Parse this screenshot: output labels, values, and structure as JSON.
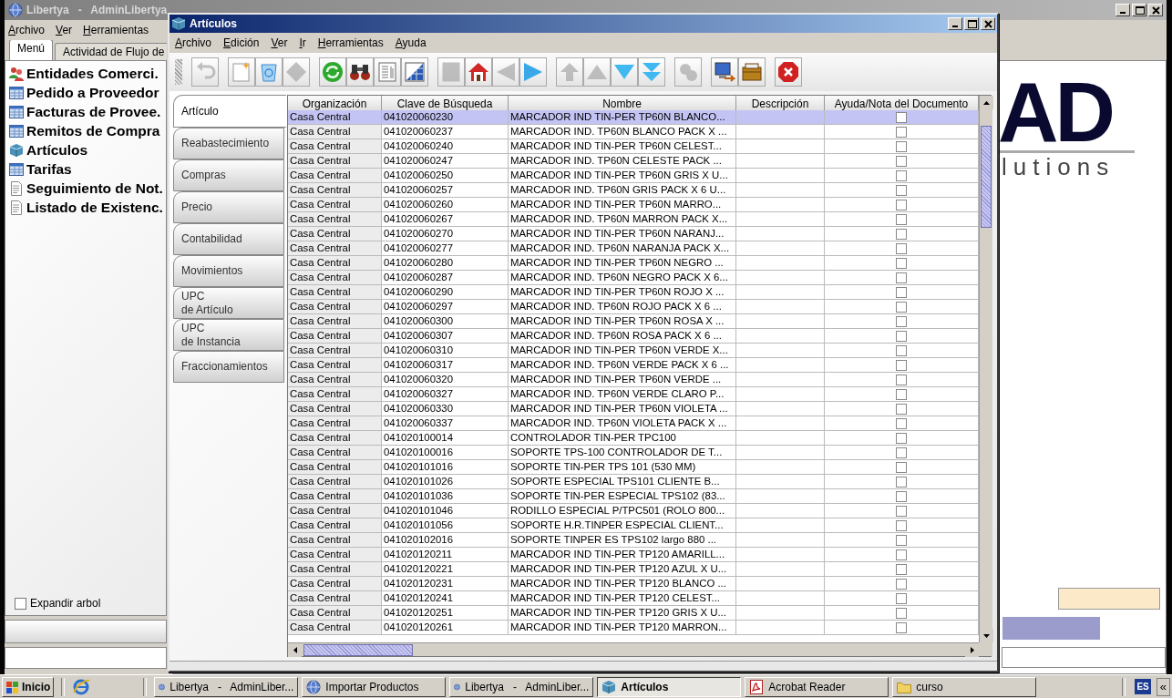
{
  "main_window": {
    "title": "Libertya   -   AdminLibertya",
    "menu": [
      "Archivo",
      "Ver",
      "Herramientas"
    ],
    "tabs": [
      {
        "label": "Menú",
        "selected": true
      },
      {
        "label": "Actividad de Flujo de",
        "selected": false
      }
    ],
    "tree": [
      {
        "label": "Entidades Comerci.",
        "kind": "partners"
      },
      {
        "label": "Pedido a Proveedor",
        "kind": "window"
      },
      {
        "label": "Facturas de Provee.",
        "kind": "window"
      },
      {
        "label": "Remitos de Compra",
        "kind": "window"
      },
      {
        "label": "Artículos",
        "kind": "product"
      },
      {
        "label": "Tarifas",
        "kind": "window"
      },
      {
        "label": "Seguimiento de Not.",
        "kind": "report"
      },
      {
        "label": "Listado de Existenc.",
        "kind": "report"
      }
    ],
    "expand_tree": {
      "label": "Expandir arbol",
      "checked": false
    },
    "logo": {
      "mark": "AD",
      "tagline": "lutions"
    }
  },
  "dialog": {
    "title": "Artículos",
    "menu": [
      "Archivo",
      "Edición",
      "Ver",
      "Ir",
      "Herramientas",
      "Ayuda"
    ],
    "toolbar": [
      [
        {
          "kind": "undo",
          "disabled": true
        }
      ],
      [
        {
          "kind": "new",
          "disabled": false
        },
        {
          "kind": "delete",
          "disabled": false
        },
        {
          "kind": "ignore",
          "disabled": true
        }
      ],
      [
        {
          "kind": "refresh",
          "disabled": false
        },
        {
          "kind": "find",
          "disabled": false
        },
        {
          "kind": "report",
          "disabled": false
        },
        {
          "kind": "grid",
          "disabled": false
        }
      ],
      [
        {
          "kind": "attachment",
          "disabled": true
        },
        {
          "kind": "home",
          "disabled": false
        },
        {
          "kind": "previous",
          "disabled": true
        },
        {
          "kind": "next",
          "disabled": false
        }
      ],
      [
        {
          "kind": "first",
          "disabled": true
        },
        {
          "kind": "up",
          "disabled": true
        },
        {
          "kind": "down",
          "disabled": false
        },
        {
          "kind": "last",
          "disabled": false
        }
      ],
      [
        {
          "kind": "workflow",
          "disabled": true
        }
      ],
      [
        {
          "kind": "export",
          "disabled": false
        },
        {
          "kind": "archive",
          "disabled": false
        }
      ],
      [
        {
          "kind": "close",
          "disabled": false
        }
      ]
    ],
    "tabs": [
      {
        "label": "Artículo",
        "selected": true
      },
      {
        "label": "Reabastecimiento",
        "selected": false
      },
      {
        "label": "Compras",
        "selected": false
      },
      {
        "label": "Precio",
        "selected": false
      },
      {
        "label": "Contabilidad",
        "selected": false
      },
      {
        "label": "Movimientos",
        "selected": false
      },
      {
        "label": "UPC\nde Artículo",
        "selected": false
      },
      {
        "label": "UPC\nde Instancia",
        "selected": false
      },
      {
        "label": "Fraccionamientos",
        "selected": false
      }
    ],
    "table": {
      "columns": [
        "Organización",
        "Clave de Búsqueda",
        "Nombre",
        "Descripción",
        "Ayuda/Nota del Documento"
      ],
      "rows": [
        {
          "org": "Casa Central",
          "key": "041020060230",
          "name": "MARCADOR IND TIN-PER TP60N BLANCO...",
          "checked": false,
          "selected": true
        },
        {
          "org": "Casa Central",
          "key": "041020060237",
          "name": "MARCADOR IND. TP60N BLANCO PACK X ...",
          "checked": false,
          "selected": false
        },
        {
          "org": "Casa Central",
          "key": "041020060240",
          "name": "MARCADOR IND TIN-PER TP60N CELEST...",
          "checked": false,
          "selected": false
        },
        {
          "org": "Casa Central",
          "key": "041020060247",
          "name": "MARCADOR IND. TP60N CELESTE PACK ...",
          "checked": false,
          "selected": false
        },
        {
          "org": "Casa Central",
          "key": "041020060250",
          "name": "MARCADOR IND TIN-PER TP60N GRIS X U...",
          "checked": false,
          "selected": false
        },
        {
          "org": "Casa Central",
          "key": "041020060257",
          "name": "MARCADOR IND. TP60N GRIS PACK X 6 U...",
          "checked": false,
          "selected": false
        },
        {
          "org": "Casa Central",
          "key": "041020060260",
          "name": "MARCADOR IND TIN-PER TP60N MARRO...",
          "checked": false,
          "selected": false
        },
        {
          "org": "Casa Central",
          "key": "041020060267",
          "name": "MARCADOR IND. TP60N MARRON PACK X...",
          "checked": false,
          "selected": false
        },
        {
          "org": "Casa Central",
          "key": "041020060270",
          "name": "MARCADOR IND TIN-PER TP60N NARANJ...",
          "checked": false,
          "selected": false
        },
        {
          "org": "Casa Central",
          "key": "041020060277",
          "name": "MARCADOR IND. TP60N NARANJA PACK X...",
          "checked": false,
          "selected": false
        },
        {
          "org": "Casa Central",
          "key": "041020060280",
          "name": "MARCADOR IND TIN-PER TP60N NEGRO ...",
          "checked": false,
          "selected": false
        },
        {
          "org": "Casa Central",
          "key": "041020060287",
          "name": "MARCADOR IND. TP60N NEGRO PACK X 6...",
          "checked": false,
          "selected": false
        },
        {
          "org": "Casa Central",
          "key": "041020060290",
          "name": "MARCADOR IND TIN-PER TP60N ROJO X ...",
          "checked": false,
          "selected": false
        },
        {
          "org": "Casa Central",
          "key": "041020060297",
          "name": "MARCADOR IND. TP60N ROJO PACK X 6 ...",
          "checked": false,
          "selected": false
        },
        {
          "org": "Casa Central",
          "key": "041020060300",
          "name": "MARCADOR IND TIN-PER TP60N ROSA X ...",
          "checked": false,
          "selected": false
        },
        {
          "org": "Casa Central",
          "key": "041020060307",
          "name": "MARCADOR IND. TP60N ROSA PACK X 6 ...",
          "checked": false,
          "selected": false
        },
        {
          "org": "Casa Central",
          "key": "041020060310",
          "name": "MARCADOR IND TIN-PER TP60N VERDE X...",
          "checked": false,
          "selected": false
        },
        {
          "org": "Casa Central",
          "key": "041020060317",
          "name": "MARCADOR IND. TP60N VERDE PACK X 6 ...",
          "checked": false,
          "selected": false
        },
        {
          "org": "Casa Central",
          "key": "041020060320",
          "name": "MARCADOR IND TIN-PER TP60N VERDE ...",
          "checked": false,
          "selected": false
        },
        {
          "org": "Casa Central",
          "key": "041020060327",
          "name": "MARCADOR IND. TP60N VERDE CLARO P...",
          "checked": false,
          "selected": false
        },
        {
          "org": "Casa Central",
          "key": "041020060330",
          "name": "MARCADOR IND TIN-PER TP60N VIOLETA ...",
          "checked": false,
          "selected": false
        },
        {
          "org": "Casa Central",
          "key": "041020060337",
          "name": "MARCADOR IND. TP60N VIOLETA PACK X ...",
          "checked": false,
          "selected": false
        },
        {
          "org": "Casa Central",
          "key": "041020100014",
          "name": "CONTROLADOR TIN-PER TPC100",
          "checked": false,
          "selected": false
        },
        {
          "org": "Casa Central",
          "key": "041020100016",
          "name": "SOPORTE TPS-100 CONTROLADOR DE T...",
          "checked": false,
          "selected": false
        },
        {
          "org": "Casa Central",
          "key": "041020101016",
          "name": "SOPORTE TIN-PER TPS 101 (530 MM)",
          "checked": false,
          "selected": false
        },
        {
          "org": "Casa Central",
          "key": "041020101026",
          "name": "SOPORTE ESPECIAL TPS101 CLIENTE B...",
          "checked": false,
          "selected": false
        },
        {
          "org": "Casa Central",
          "key": "041020101036",
          "name": "SOPORTE TIN-PER ESPECIAL TPS102 (83...",
          "checked": false,
          "selected": false
        },
        {
          "org": "Casa Central",
          "key": "041020101046",
          "name": "RODILLO ESPECIAL P/TPC501 (ROLO 800...",
          "checked": false,
          "selected": false
        },
        {
          "org": "Casa Central",
          "key": "041020101056",
          "name": "SOPORTE H.R.TINPER ESPECIAL CLIENT...",
          "checked": false,
          "selected": false
        },
        {
          "org": "Casa Central",
          "key": "041020102016",
          "name": "SOPORTE TINPER ES TPS102 largo 880 ...",
          "checked": false,
          "selected": false
        },
        {
          "org": "Casa Central",
          "key": "041020120211",
          "name": "MARCADOR IND TIN-PER TP120 AMARILL...",
          "checked": false,
          "selected": false
        },
        {
          "org": "Casa Central",
          "key": "041020120221",
          "name": "MARCADOR IND TIN-PER TP120 AZUL X U...",
          "checked": false,
          "selected": false
        },
        {
          "org": "Casa Central",
          "key": "041020120231",
          "name": "MARCADOR IND TIN-PER TP120 BLANCO ...",
          "checked": false,
          "selected": false
        },
        {
          "org": "Casa Central",
          "key": "041020120241",
          "name": "MARCADOR IND TIN-PER TP120 CELEST...",
          "checked": false,
          "selected": false
        },
        {
          "org": "Casa Central",
          "key": "041020120251",
          "name": "MARCADOR IND TIN-PER TP120 GRIS X U...",
          "checked": false,
          "selected": false
        },
        {
          "org": "Casa Central",
          "key": "041020120261",
          "name": "MARCADOR IND TIN-PER TP120 MARRON...",
          "checked": false,
          "selected": false
        }
      ]
    }
  },
  "taskbar": {
    "start": "Inicio",
    "tasks": [
      {
        "label": "Libertya   -   AdminLiber...",
        "kind": "app",
        "selected": false
      },
      {
        "label": "Importar Productos",
        "kind": "app",
        "selected": false
      },
      {
        "label": "Libertya   -   AdminLiber...",
        "kind": "app",
        "selected": false
      },
      {
        "label": "Artículos",
        "kind": "product",
        "selected": true
      },
      {
        "label": "Acrobat Reader",
        "kind": "pdf",
        "selected": false
      },
      {
        "label": "curso",
        "kind": "folder",
        "selected": false
      }
    ],
    "language": "ES",
    "expand": "«"
  }
}
